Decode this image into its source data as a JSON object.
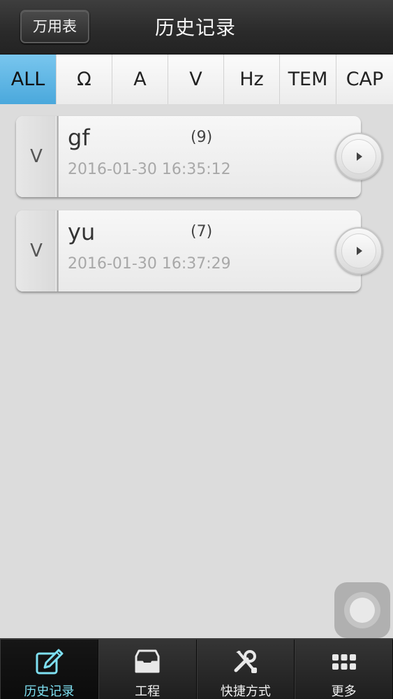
{
  "header": {
    "back_label": "万用表",
    "title": "历史记录"
  },
  "tabs": [
    {
      "label": "ALL",
      "active": true
    },
    {
      "label": "Ω",
      "active": false
    },
    {
      "label": "A",
      "active": false
    },
    {
      "label": "V",
      "active": false
    },
    {
      "label": "Hz",
      "active": false
    },
    {
      "label": "TEM",
      "active": false
    },
    {
      "label": "CAP",
      "active": false
    }
  ],
  "records": [
    {
      "type": "V",
      "name": "gf",
      "count": "(9)",
      "date": "2016-01-30 16:35:12"
    },
    {
      "type": "V",
      "name": "yu",
      "count": "(7)",
      "date": "2016-01-30 16:37:29"
    }
  ],
  "bottom_nav": [
    {
      "label": "历史记录",
      "icon": "edit-icon",
      "active": true
    },
    {
      "label": "工程",
      "icon": "inbox-icon",
      "active": false
    },
    {
      "label": "快捷方式",
      "icon": "tools-icon",
      "active": false
    },
    {
      "label": "更多",
      "icon": "grid-icon",
      "active": false
    }
  ],
  "colors": {
    "accent": "#5ab4e4",
    "active_nav_label": "#7ee0f2",
    "header_bg": "#2f2f2f",
    "page_bg": "#dcdcdc"
  }
}
